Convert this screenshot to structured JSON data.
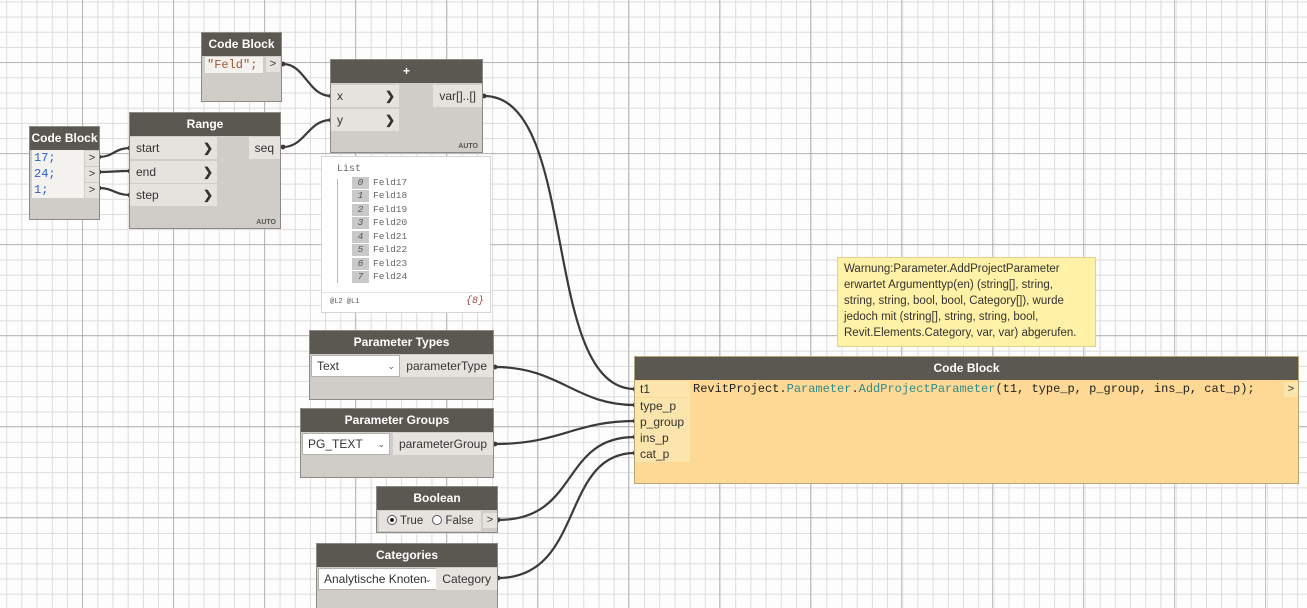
{
  "nodes": {
    "feld_block": {
      "title": "Code Block",
      "code": "\"Feld\";",
      "out": ">"
    },
    "numbers_block": {
      "title": "Code Block",
      "lines": [
        "17;",
        "24;",
        "1;"
      ],
      "out": ">"
    },
    "range": {
      "title": "Range",
      "inputs": [
        "start",
        "end",
        "step"
      ],
      "output": "seq",
      "lacing": "AUTO"
    },
    "plus": {
      "title": "+",
      "inputs": [
        "x",
        "y"
      ],
      "output": "var[]..[]",
      "lacing": "AUTO"
    },
    "param_types": {
      "title": "Parameter Types",
      "selected": "Text",
      "output": "parameterType"
    },
    "param_groups": {
      "title": "Parameter Groups",
      "selected": "PG_TEXT",
      "output": "parameterGroup"
    },
    "boolean": {
      "title": "Boolean",
      "true_label": "True",
      "false_label": "False",
      "selected": "True",
      "out": ">"
    },
    "categories": {
      "title": "Categories",
      "selected": "Analytische Knoten",
      "output": "Category"
    },
    "main_block": {
      "title": "Code Block",
      "inputs": [
        "t1",
        "type_p",
        "p_group",
        "ins_p",
        "cat_p"
      ],
      "code_prefix": "RevitProject.",
      "code_class": "Parameter",
      "code_dot": ".",
      "code_method": "AddProjectParameter",
      "code_args": "(t1, type_p, p_group, ins_p, cat_p);",
      "out": ">",
      "state_color": "#fdd995"
    }
  },
  "preview": {
    "header": "List",
    "items": [
      {
        "index": "0",
        "value": "Feld17"
      },
      {
        "index": "1",
        "value": "Feld18"
      },
      {
        "index": "2",
        "value": "Feld19"
      },
      {
        "index": "3",
        "value": "Feld20"
      },
      {
        "index": "4",
        "value": "Feld21"
      },
      {
        "index": "5",
        "value": "Feld22"
      },
      {
        "index": "6",
        "value": "Feld23"
      },
      {
        "index": "7",
        "value": "Feld24"
      }
    ],
    "levels": "@L2 @L1",
    "count": "{8}"
  },
  "warning": {
    "lines": [
      "Warnung:Parameter.AddProjectParameter",
      "erwartet Argumenttyp(en) (string[], string,",
      "string, string, bool, bool, Category[]), wurde",
      "jedoch mit (string[], string, string, bool,",
      "Revit.Elements.Category, var, var) abgerufen."
    ],
    "color": "#fff1a6"
  },
  "colors": {
    "header": "#5b5751",
    "node_body": "#d0cdc8",
    "wire": "#3a3a3a"
  }
}
